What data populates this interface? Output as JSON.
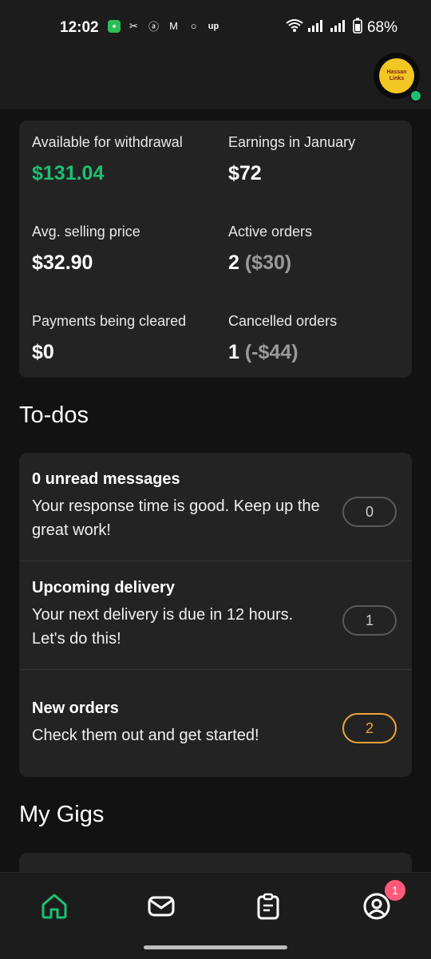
{
  "status_bar": {
    "time": "12:02",
    "battery": "68%"
  },
  "avatar": {
    "text": "Hassan Links",
    "online": true
  },
  "stats": {
    "available_label": "Available for withdrawal",
    "available_value": "$131.04",
    "earnings_label": "Earnings in January",
    "earnings_value": "$72",
    "avg_label": "Avg. selling price",
    "avg_value": "$32.90",
    "active_label": "Active orders",
    "active_count": "2",
    "active_amount": "($30)",
    "payments_label": "Payments being cleared",
    "payments_value": "$0",
    "cancelled_label": "Cancelled orders",
    "cancelled_count": "1",
    "cancelled_amount": "(-$44)"
  },
  "todos": {
    "title": "To-dos",
    "items": [
      {
        "title": "0 unread messages",
        "desc": "Your response time is good. Keep up the great work!",
        "count": "0"
      },
      {
        "title": "Upcoming delivery",
        "desc": "Your next delivery is due in 12 hours. Let's do this!",
        "count": "1"
      },
      {
        "title": "New orders",
        "desc": "Check them out and get started!",
        "count": "2"
      }
    ]
  },
  "gigs": {
    "title": "My Gigs"
  },
  "nav": {
    "items": [
      {
        "icon": "home-icon",
        "active": true
      },
      {
        "icon": "inbox-icon",
        "active": false
      },
      {
        "icon": "orders-icon",
        "active": false
      },
      {
        "icon": "profile-icon",
        "active": false
      }
    ],
    "profile_badge": "1"
  },
  "colors": {
    "accent_green": "#1dbf73",
    "orange": "#f0a43a",
    "badge_pink": "#ff5a7a"
  }
}
